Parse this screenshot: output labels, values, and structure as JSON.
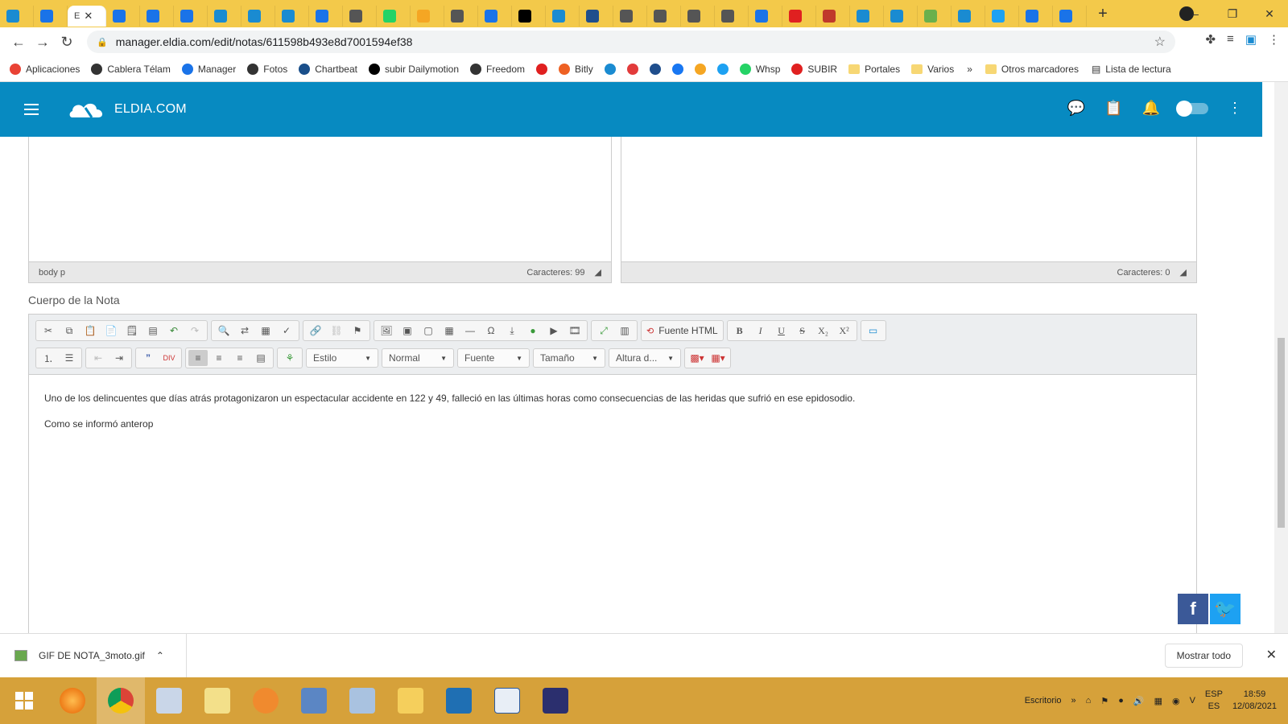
{
  "browser": {
    "active_tab_label": "E",
    "tab_close": "✕",
    "new_tab": "+",
    "url": "manager.eldia.com/edit/notas/611598b493e8d7001594ef38"
  },
  "bookmarks": [
    {
      "label": "Aplicaciones",
      "color": "#e94235"
    },
    {
      "label": "Cablera Télam",
      "color": "#333333"
    },
    {
      "label": "Manager",
      "color": "#1a73e8"
    },
    {
      "label": "Fotos",
      "color": "#333333"
    },
    {
      "label": "Chartbeat",
      "color": "#1a4f8a"
    },
    {
      "label": "subir Dailymotion",
      "color": "#000000"
    },
    {
      "label": "Freedom",
      "color": "#333333"
    },
    {
      "label": "",
      "color": "#e02020"
    },
    {
      "label": "Bitly",
      "color": "#ee6123"
    },
    {
      "label": "",
      "color": "#1a8bd1"
    },
    {
      "label": "",
      "color": "#e23b3b"
    },
    {
      "label": "",
      "color": "#1f4e8c"
    },
    {
      "label": "",
      "color": "#1877f2"
    },
    {
      "label": "",
      "color": "#f5a623"
    },
    {
      "label": "",
      "color": "#1da1f2"
    },
    {
      "label": "Whsp",
      "color": "#25d366"
    },
    {
      "label": "SUBIR",
      "color": "#e02020"
    },
    {
      "label": "Portales",
      "folder": true
    },
    {
      "label": "Varios",
      "folder": true
    }
  ],
  "bookmarks_more": "»",
  "bookmarks_other": "Otros marcadores",
  "bookmarks_reading": "Lista de lectura",
  "app": {
    "brand": "ELDIA.COM",
    "brand_color": "#078ac1"
  },
  "editors": {
    "left_path": "body  p",
    "left_count": "Caracteres: 99",
    "right_count": "Caracteres: 0"
  },
  "body_section": {
    "title": "Cuerpo de la Nota",
    "html_source": "Fuente HTML",
    "combos": {
      "style": "Estilo",
      "format": "Normal",
      "font": "Fuente",
      "size": "Tamaño",
      "height": "Altura d..."
    },
    "paragraphs": [
      "Uno de los delincuentes que días atrás protagonizaron un espectacular accidente en 122 y 49, falleció en las últimas horas como consecuencias de las heridas que sufrió en ese epidosodio.",
      "Como se informó anterop"
    ]
  },
  "download": {
    "file": "GIF DE NOTA_3moto.gif",
    "show_all": "Mostrar todo"
  },
  "taskbar": {
    "desktop_label": "Escritorio",
    "lang_top": "ESP",
    "lang_bottom": "ES",
    "time": "18:59",
    "date": "12/08/2021"
  }
}
